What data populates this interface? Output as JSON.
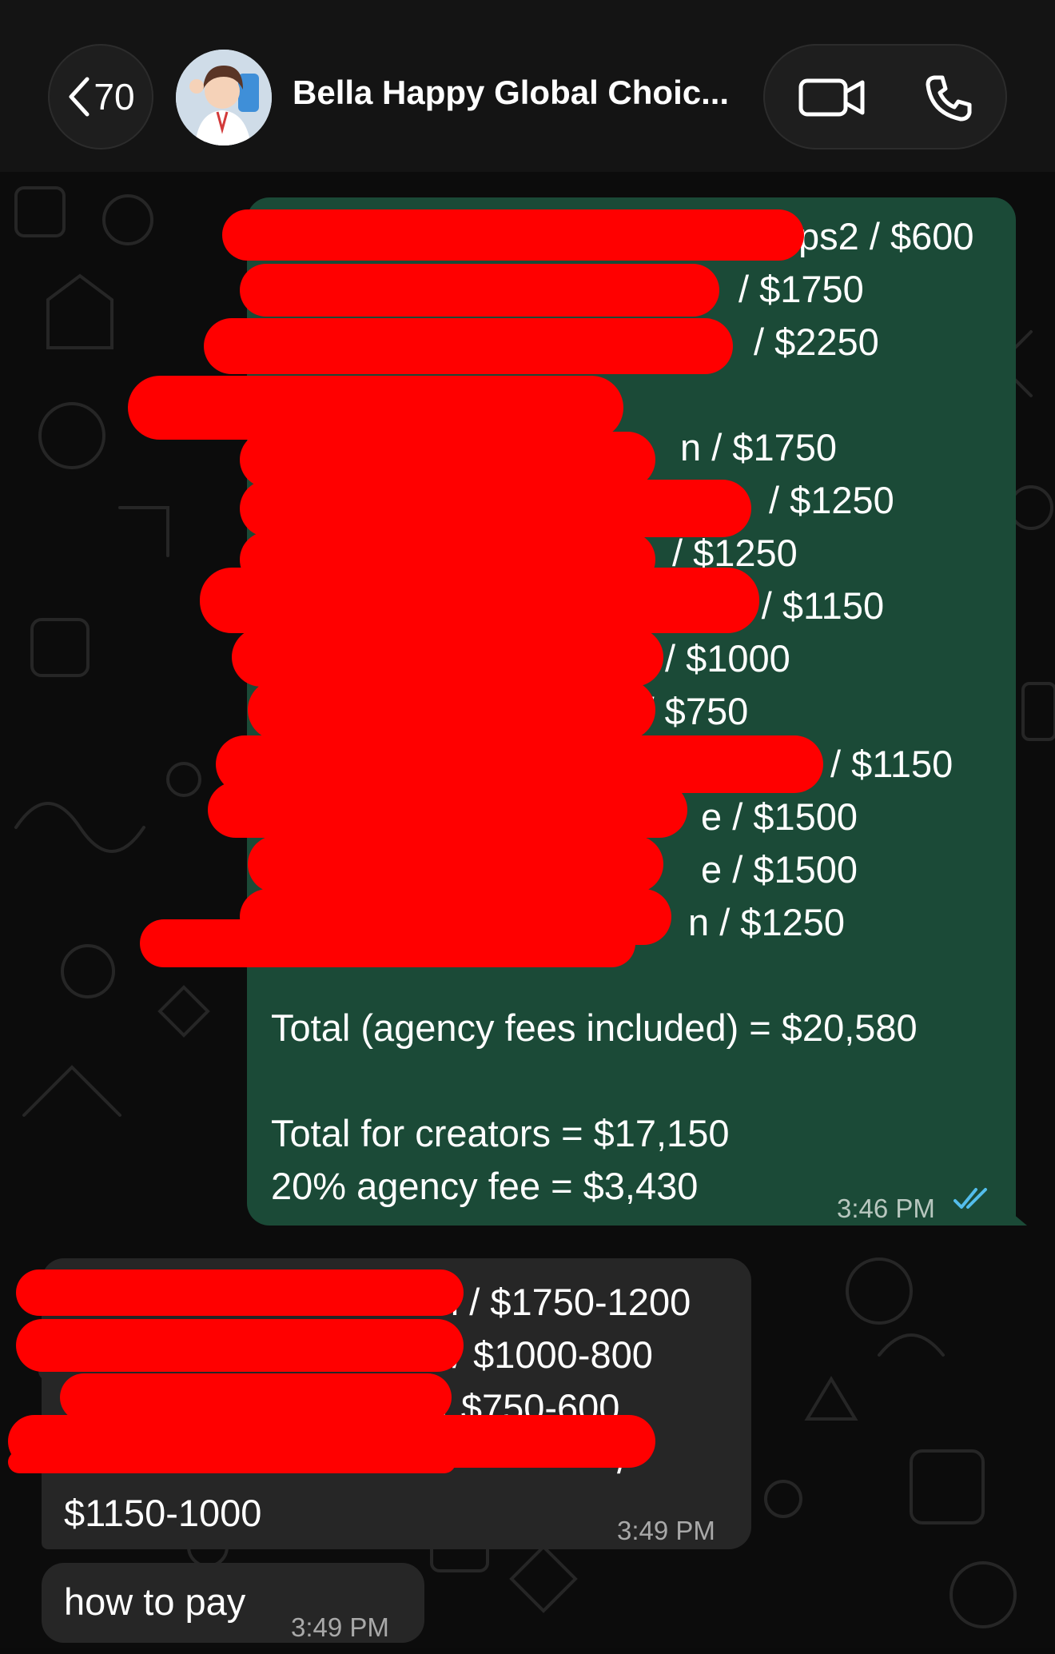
{
  "header": {
    "back_count": "70",
    "contact_name": "Bella Happy Global Choic...",
    "back_icon": "chevron-left-icon",
    "video_icon": "video-camera-icon",
    "phone_icon": "phone-icon"
  },
  "outgoing_message": {
    "lines": [
      "ps2 / $600",
      "/ $1750",
      "/ $2250",
      "",
      "n / $1750",
      "/ $1250",
      "/ $1250",
      "ani / $1150",
      "ls / $1000",
      "s / $750",
      "/ $1150",
      "e / $1500",
      "e / $1500",
      "n / $1250"
    ],
    "total": "Total (agency fees included) = $20,580",
    "creators": "Total for creators = $17,150",
    "fee": "20% agency fee = $3,430",
    "time": "3:46 PM",
    "read_icon": "double-check-icon"
  },
  "incoming_message_1": {
    "lines": [
      "n / $1750-1200",
      "/ $1000-800",
      "ps / $750-600",
      "/",
      "$1150-1000"
    ],
    "time": "3:49 PM"
  },
  "incoming_message_2": {
    "text": "how to pay",
    "time": "3:49 PM"
  },
  "colors": {
    "outgoing_bubble": "#1b4a37",
    "incoming_bubble": "#262626",
    "redaction": "#ff0000",
    "read_tick": "#53bdeb"
  }
}
